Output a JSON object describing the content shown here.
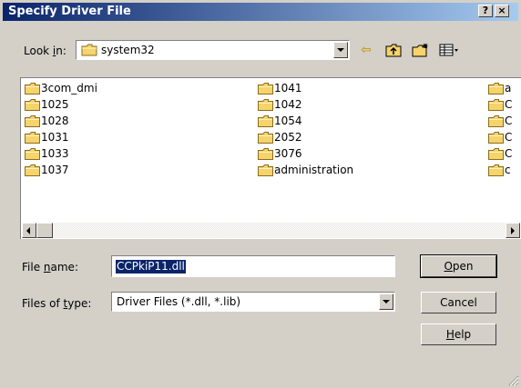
{
  "window": {
    "title": "Specify Driver File",
    "help_glyph": "?",
    "close_glyph": "×"
  },
  "lookin": {
    "label": "Look in:",
    "value": "system32"
  },
  "toolbar": {
    "back_icon": "back-arrow-icon",
    "up_icon": "up-folder-icon",
    "new_folder_icon": "new-folder-icon",
    "view_icon": "view-menu-icon"
  },
  "files": [
    {
      "name": "3com_dmi"
    },
    {
      "name": "1025"
    },
    {
      "name": "1028"
    },
    {
      "name": "1031"
    },
    {
      "name": "1033"
    },
    {
      "name": "1037"
    },
    {
      "name": "1041"
    },
    {
      "name": "1042"
    },
    {
      "name": "1054"
    },
    {
      "name": "2052"
    },
    {
      "name": "3076"
    },
    {
      "name": "administration"
    },
    {
      "name": "a"
    },
    {
      "name": "C"
    },
    {
      "name": "C"
    },
    {
      "name": "C"
    },
    {
      "name": "C"
    },
    {
      "name": "c"
    }
  ],
  "filename": {
    "label": "File name:",
    "value": "CCPkiP11.dll"
  },
  "filetype": {
    "label": "Files of type:",
    "value": "Driver Files (*.dll, *.lib)"
  },
  "buttons": {
    "open": "Open",
    "cancel": "Cancel",
    "help": "Help"
  },
  "colors": {
    "title_active": "#0a246a",
    "face": "#d4d0c8",
    "folder": "#f6d36b"
  }
}
